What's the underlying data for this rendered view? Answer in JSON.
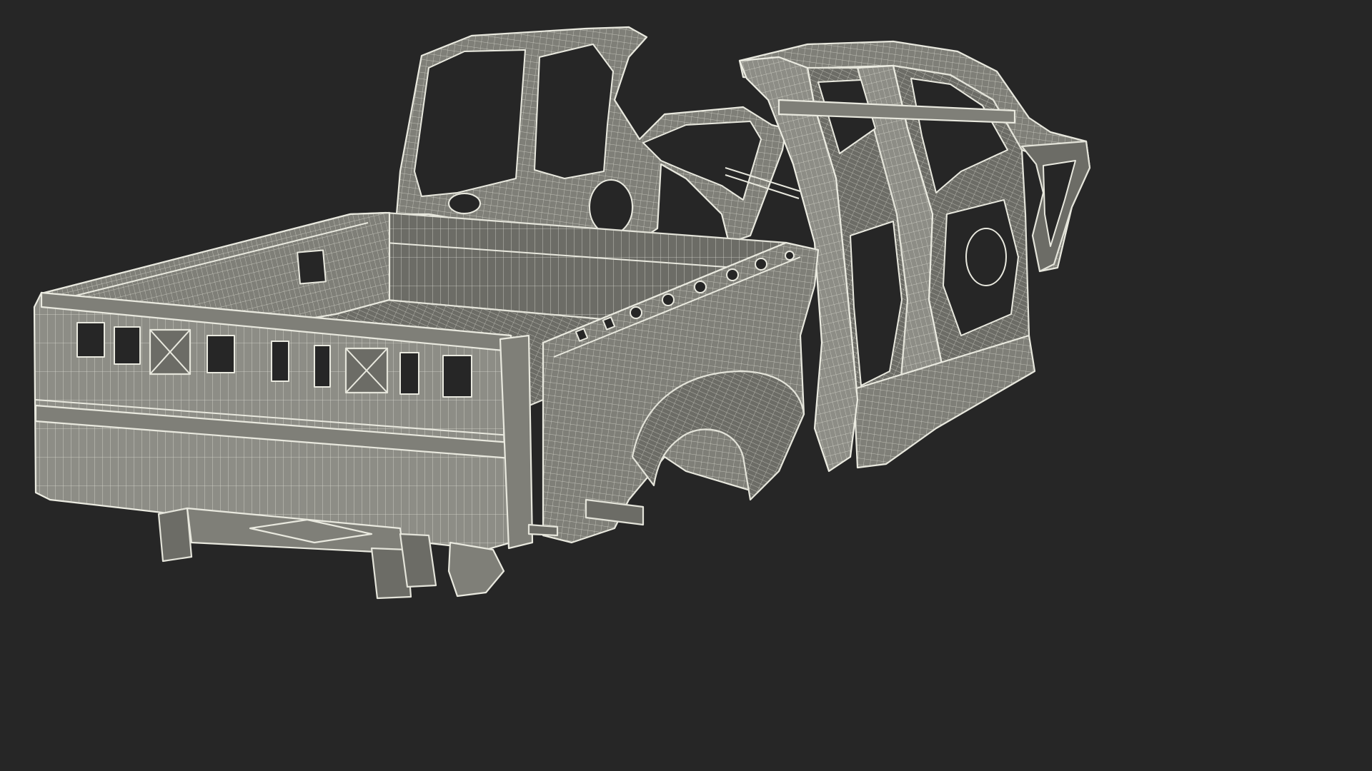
{
  "scene": {
    "subject": "pickup-truck-body-in-white-wireframe",
    "colors": {
      "background": "#262626",
      "surface": "#7f7f78",
      "surface_dark": "#6c6c66",
      "wire": "#e9e9df"
    }
  }
}
